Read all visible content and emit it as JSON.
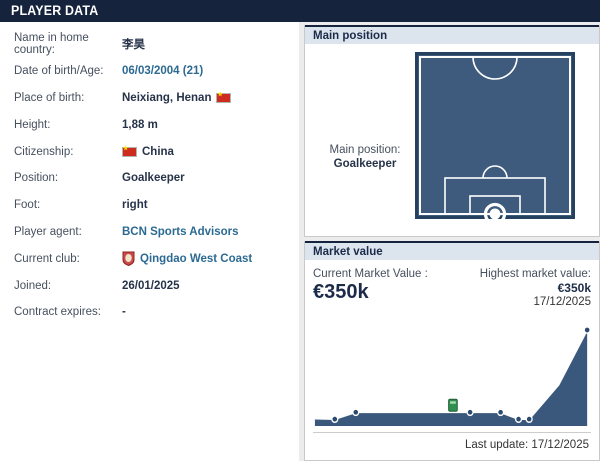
{
  "header": {
    "title": "PLAYER DATA"
  },
  "player_info": {
    "rows": [
      {
        "label": "Name in home country:",
        "value": "李昊"
      },
      {
        "label": "Date of birth/Age:",
        "value": "06/03/2004 (21)"
      },
      {
        "label": "Place of birth:",
        "value": "Neixiang, Henan",
        "flag": "China"
      },
      {
        "label": "Height:",
        "value": "1,88 m"
      },
      {
        "label": "Citizenship:",
        "value": "China",
        "flag": "China"
      },
      {
        "label": "Position:",
        "value": "Goalkeeper"
      },
      {
        "label": "Foot:",
        "value": "right"
      },
      {
        "label": "Player agent:",
        "value": "BCN Sports Advisors"
      },
      {
        "label": "Current club:",
        "value": "Qingdao West Coast"
      },
      {
        "label": "Joined:",
        "value": "26/01/2025"
      },
      {
        "label": "Contract expires:",
        "value": "-"
      }
    ]
  },
  "main_position": {
    "panel_title": "Main position",
    "label": "Main position:",
    "value": "Goalkeeper"
  },
  "market_value": {
    "panel_title": "Market value",
    "current_label": "Current Market Value :",
    "current_value": "€350k",
    "highest_label": "Highest market value:",
    "highest_value": "€350k",
    "highest_date": "17/12/2025",
    "last_update": "Last update: 17/12/2025"
  },
  "colors": {
    "header_navy": "#16233d",
    "panel_band_blue": "#dce4ee",
    "link_blue": "#2c6a93",
    "pitch_fill": "#3e5a7c",
    "pitch_frame": "#24415f",
    "chart_fill": "#3a587c",
    "chart_dot": "#2b4a6e",
    "club_marker_green": "#2f8f4f",
    "flag_red": "#cc2b1d"
  },
  "chart_data": {
    "type": "area",
    "title": "Market value history",
    "currency": "EUR",
    "grid": false,
    "legend": false,
    "ylim": [
      0,
      380000
    ],
    "note": "values in euros, estimated from pixel heights; peak anchored to highest value 350k on 17/12/2025",
    "points": [
      {
        "x": 0.0,
        "value": 27000,
        "marker": false
      },
      {
        "x": 0.073,
        "value": 25000,
        "marker": true
      },
      {
        "x": 0.15,
        "value": 50000,
        "marker": true
      },
      {
        "x": 0.57,
        "value": 50000,
        "marker": true
      },
      {
        "x": 0.682,
        "value": 50000,
        "marker": true
      },
      {
        "x": 0.748,
        "value": 25000,
        "marker": true
      },
      {
        "x": 0.787,
        "value": 25000,
        "marker": true
      },
      {
        "x": 0.895,
        "value": 150000,
        "marker": false
      },
      {
        "x": 1.0,
        "value": 350000,
        "marker": true
      }
    ],
    "club_marker": {
      "x": 0.507,
      "value": 50000,
      "club": "Qingdao West Coast"
    }
  }
}
